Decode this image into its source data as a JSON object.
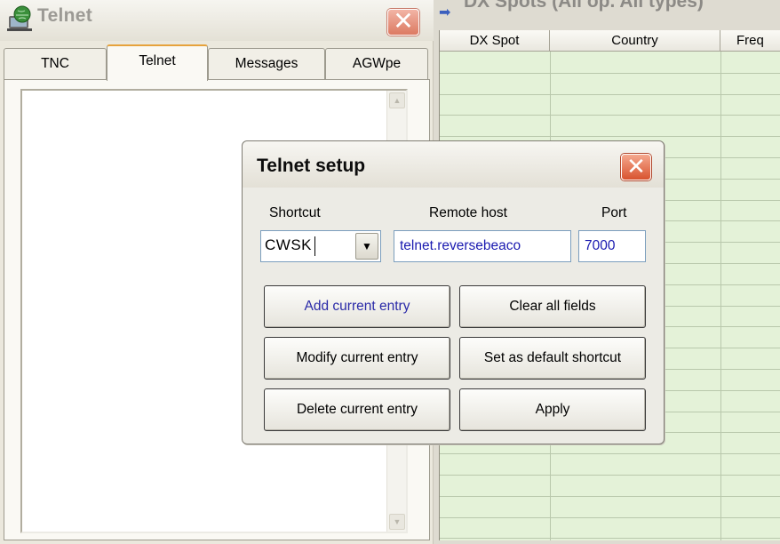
{
  "telnet_window": {
    "title": "Telnet",
    "close_glyph": "✕",
    "tabs": [
      {
        "label": "TNC"
      },
      {
        "label": "Telnet"
      },
      {
        "label": "Messages"
      },
      {
        "label": "AGWpe"
      }
    ],
    "active_tab": "Telnet",
    "title_icon": "globe-computer-icon"
  },
  "dx_window": {
    "title": "DX Spots (All op. All types)",
    "columns": [
      "DX Spot",
      "Country",
      "Freq"
    ],
    "row_color": "#e4f2d8"
  },
  "dialog": {
    "title": "Telnet setup",
    "close_glyph": "✕",
    "labels": {
      "shortcut": "Shortcut",
      "remote_host": "Remote host",
      "port": "Port"
    },
    "shortcut_value": "CWSK",
    "remote_host_value": "telnet.reversebeaco",
    "port_value": "7000",
    "dropdown_glyph": "▼",
    "buttons": {
      "add": "Add current entry",
      "clear": "Clear all fields",
      "modify": "Modify current entry",
      "set_default": "Set as default shortcut",
      "delete": "Delete current entry",
      "apply": "Apply"
    }
  },
  "colors": {
    "close_button": "#d8532f",
    "link_text": "#2a2aa8",
    "active_tab_accent": "#e6a23c"
  }
}
